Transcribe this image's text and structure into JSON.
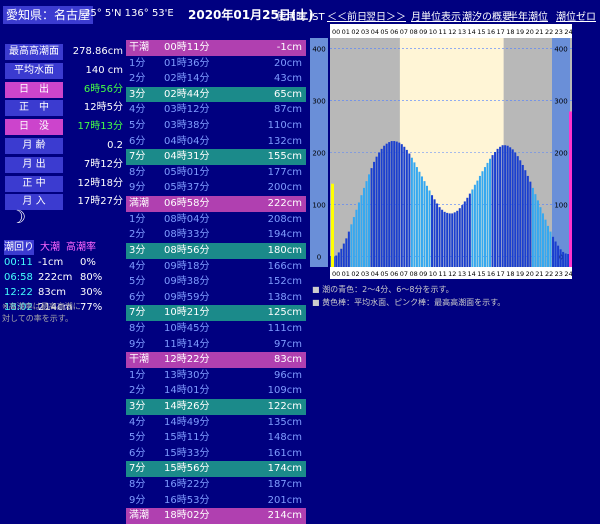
{
  "header": {
    "location": "愛知県：名古屋",
    "coords": "35° 5'N 136° 53'E",
    "date": "2020年01月25日(土)",
    "jst": "使用時 JST",
    "links": [
      "＜＜前日",
      "翌日＞＞",
      "月単位表示",
      "潮汐の概要",
      "半年潮位",
      "潮位ゼロ"
    ]
  },
  "summary": [
    {
      "label": "最高高潮面",
      "value": "278.86cm",
      "style": "",
      "vstyle": ""
    },
    {
      "label": "平均水面",
      "value": "140 cm",
      "style": "",
      "vstyle": ""
    },
    {
      "label": "日　出",
      "value": "6時56分",
      "style": "pink",
      "vstyle": "green"
    },
    {
      "label": "正　中",
      "value": "12時5分",
      "style": "",
      "vstyle": ""
    },
    {
      "label": "日　没",
      "value": "17時13分",
      "style": "pink",
      "vstyle": "green"
    },
    {
      "label": "月 齢",
      "value": "0.2",
      "style": "",
      "vstyle": ""
    },
    {
      "label": "月 出",
      "value": "7時12分",
      "style": "",
      "vstyle": ""
    },
    {
      "label": "正 中",
      "value": "12時18分",
      "style": "",
      "vstyle": ""
    },
    {
      "label": "月 入",
      "value": "17時27分",
      "style": "",
      "vstyle": ""
    }
  ],
  "moon": "☽",
  "tide_rounds": {
    "headers": [
      "潮回り",
      "大潮",
      "高潮率"
    ],
    "rows": [
      [
        "00:11",
        "-1cm",
        "0%"
      ],
      [
        "06:58",
        "222cm",
        "80%"
      ],
      [
        "12:22",
        "83cm",
        "30%"
      ],
      [
        "18:02",
        "214cm",
        "77%"
      ]
    ]
  },
  "note": [
    "※高潮率は最高高潮に",
    "対しての率を示す。"
  ],
  "tide_table": [
    {
      "label": "干潮",
      "time": "00時11分",
      "value": "-1cm",
      "kind": "k"
    },
    {
      "label": "1分",
      "time": "01時36分",
      "value": "20cm",
      "kind": "o"
    },
    {
      "label": "2分",
      "time": "02時14分",
      "value": "43cm",
      "kind": "o"
    },
    {
      "label": "3分",
      "time": "02時44分",
      "value": "65cm",
      "kind": "c"
    },
    {
      "label": "4分",
      "time": "03時12分",
      "value": "87cm",
      "kind": "o"
    },
    {
      "label": "5分",
      "time": "03時38分",
      "value": "110cm",
      "kind": "o"
    },
    {
      "label": "6分",
      "time": "04時04分",
      "value": "132cm",
      "kind": "o"
    },
    {
      "label": "7分",
      "time": "04時31分",
      "value": "155cm",
      "kind": "c"
    },
    {
      "label": "8分",
      "time": "05時01分",
      "value": "177cm",
      "kind": "o"
    },
    {
      "label": "9分",
      "time": "05時37分",
      "value": "200cm",
      "kind": "o"
    },
    {
      "label": "満潮",
      "time": "06時58分",
      "value": "222cm",
      "kind": "k"
    },
    {
      "label": "1分",
      "time": "08時04分",
      "value": "208cm",
      "kind": "o"
    },
    {
      "label": "2分",
      "time": "08時33分",
      "value": "194cm",
      "kind": "o"
    },
    {
      "label": "3分",
      "time": "08時56分",
      "value": "180cm",
      "kind": "c"
    },
    {
      "label": "4分",
      "time": "09時18分",
      "value": "166cm",
      "kind": "o"
    },
    {
      "label": "5分",
      "time": "09時38分",
      "value": "152cm",
      "kind": "o"
    },
    {
      "label": "6分",
      "time": "09時59分",
      "value": "138cm",
      "kind": "o"
    },
    {
      "label": "7分",
      "time": "10時21分",
      "value": "125cm",
      "kind": "c"
    },
    {
      "label": "8分",
      "time": "10時45分",
      "value": "111cm",
      "kind": "o"
    },
    {
      "label": "9分",
      "time": "11時14分",
      "value": "97cm",
      "kind": "o"
    },
    {
      "label": "干潮",
      "time": "12時22分",
      "value": "83cm",
      "kind": "k"
    },
    {
      "label": "1分",
      "time": "13時30分",
      "value": "96cm",
      "kind": "o"
    },
    {
      "label": "2分",
      "time": "14時01分",
      "value": "109cm",
      "kind": "o"
    },
    {
      "label": "3分",
      "time": "14時26分",
      "value": "122cm",
      "kind": "c"
    },
    {
      "label": "4分",
      "time": "14時49分",
      "value": "135cm",
      "kind": "o"
    },
    {
      "label": "5分",
      "time": "15時11分",
      "value": "148cm",
      "kind": "o"
    },
    {
      "label": "6分",
      "time": "15時33分",
      "value": "161cm",
      "kind": "o"
    },
    {
      "label": "7分",
      "time": "15時56分",
      "value": "174cm",
      "kind": "c"
    },
    {
      "label": "8分",
      "time": "16時22分",
      "value": "187cm",
      "kind": "o"
    },
    {
      "label": "9分",
      "time": "16時53分",
      "value": "201cm",
      "kind": "o"
    },
    {
      "label": "満潮",
      "time": "18時02分",
      "value": "214cm",
      "kind": "k"
    }
  ],
  "legend": [
    "■ 潮の青色：2〜4分、6〜8分を示す。",
    "■ 黄色棒：平均水面、ピンク棒：最高高潮面を示す。"
  ],
  "chart_data": {
    "type": "bar",
    "x": [
      0,
      0.25,
      0.5,
      0.75,
      1,
      1.25,
      1.5,
      1.75,
      2,
      2.25,
      2.5,
      2.75,
      3,
      3.25,
      3.5,
      3.75,
      4,
      4.25,
      4.5,
      4.75,
      5,
      5.25,
      5.5,
      5.75,
      6,
      6.25,
      6.5,
      6.75,
      7,
      7.25,
      7.5,
      7.75,
      8,
      8.25,
      8.5,
      8.75,
      9,
      9.25,
      9.5,
      9.75,
      10,
      10.25,
      10.5,
      10.75,
      11,
      11.25,
      11.5,
      11.75,
      12,
      12.25,
      12.5,
      12.75,
      13,
      13.25,
      13.5,
      13.75,
      14,
      14.25,
      14.5,
      14.75,
      15,
      15.25,
      15.5,
      15.75,
      16,
      16.25,
      16.5,
      16.75,
      17,
      17.25,
      17.5,
      17.75,
      18,
      18.25,
      18.5,
      18.75,
      19,
      19.25,
      19.5,
      19.75,
      20,
      20.25,
      20.5,
      20.75,
      21,
      21.25,
      21.5,
      21.75,
      22,
      22.25,
      22.5,
      22.75,
      23,
      23.25,
      23.5,
      23.75
    ],
    "values": [
      1,
      0,
      2,
      8,
      15,
      25,
      35,
      48,
      62,
      76,
      90,
      104,
      118,
      132,
      145,
      158,
      170,
      182,
      192,
      200,
      207,
      213,
      217,
      220,
      222,
      222,
      221,
      219,
      216,
      211,
      205,
      198,
      190,
      181,
      172,
      163,
      154,
      145,
      136,
      127,
      118,
      110,
      102,
      95,
      90,
      86,
      84,
      83,
      83,
      85,
      88,
      93,
      99,
      106,
      113,
      121,
      129,
      138,
      146,
      155,
      164,
      172,
      180,
      188,
      195,
      201,
      207,
      211,
      214,
      214,
      213,
      210,
      206,
      200,
      193,
      185,
      176,
      166,
      155,
      144,
      132,
      120,
      108,
      95,
      83,
      71,
      59,
      48,
      38,
      29,
      21,
      14,
      9,
      6,
      5,
      6
    ],
    "ylim": [
      -20,
      420
    ],
    "xlabel": "",
    "ylabel": "",
    "yticks": [
      0,
      100,
      200,
      300,
      400
    ],
    "hours": [
      "00",
      "01",
      "02",
      "03",
      "04",
      "05",
      "06",
      "07",
      "08",
      "09",
      "10",
      "11",
      "12",
      "13",
      "14",
      "15",
      "16",
      "17",
      "18",
      "19",
      "20",
      "21",
      "22",
      "23",
      "24"
    ],
    "daylight": [
      6.93,
      17.22
    ],
    "mean_level": 140,
    "max_level": 278.86,
    "colors": {
      "bar": "#1a3fcf",
      "bar_light": "#36a8f0",
      "daylight": "#fff5d6",
      "night": "#b8b8b8",
      "plot_bg": "#ffffff",
      "mean": "#ffff00",
      "max": "#ff33cc",
      "grid": "#000080"
    }
  }
}
